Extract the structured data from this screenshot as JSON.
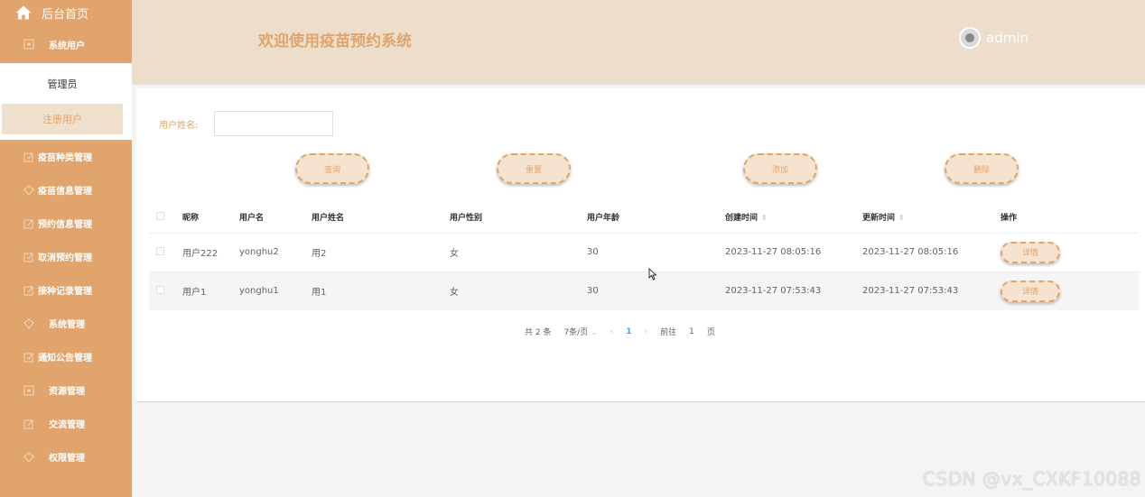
{
  "sidebar": {
    "home_label": "后台首页",
    "group_label": "系统用户",
    "sub_items": [
      "管理员",
      "注册用户"
    ],
    "items": [
      {
        "label": "疫苗种类管理",
        "icon": "edit-square-icon"
      },
      {
        "label": "疫苗信息管理",
        "icon": "diamond-icon"
      },
      {
        "label": "预约信息管理",
        "icon": "edit-icon"
      },
      {
        "label": "取消预约管理",
        "icon": "edit-square-icon"
      },
      {
        "label": "接种记录管理",
        "icon": "edit-icon"
      },
      {
        "label": "系统管理",
        "icon": "diamond-icon"
      },
      {
        "label": "通知公告管理",
        "icon": "edit-square-icon"
      },
      {
        "label": "资源管理",
        "icon": "square-dot-icon"
      },
      {
        "label": "交流管理",
        "icon": "edit-icon"
      },
      {
        "label": "权限管理",
        "icon": "diamond-icon"
      }
    ]
  },
  "header": {
    "title": "欢迎使用疫苗预约系统",
    "username": "admin"
  },
  "search": {
    "label": "用户姓名:",
    "value": ""
  },
  "buttons": {
    "query": "查询",
    "reset": "重置",
    "add": "添加",
    "delete": "删除"
  },
  "table": {
    "columns": [
      "昵称",
      "用户名",
      "用户姓名",
      "用户性别",
      "用户年龄",
      "创建时间",
      "更新时间",
      "操作"
    ],
    "rows": [
      {
        "nickname": "用户222",
        "username": "yonghu2",
        "name": "用2",
        "gender": "女",
        "age": "30",
        "created": "2023-11-27 08:05:16",
        "updated": "2023-11-27 08:05:16",
        "action": "详情"
      },
      {
        "nickname": "用户1",
        "username": "yonghu1",
        "name": "用1",
        "gender": "女",
        "age": "30",
        "created": "2023-11-27 07:53:43",
        "updated": "2023-11-27 07:53:43",
        "action": "详情"
      }
    ]
  },
  "pagination": {
    "total": "共 2 条",
    "page_size": "7条/页",
    "current": "1",
    "goto_prefix": "前往",
    "goto_value": "1",
    "goto_suffix": "页"
  },
  "watermark": "CSDN @vx_CXKF10088",
  "colors": {
    "accent": "#e0a46c",
    "header_bg": "#ecdecb",
    "active_sub_bg": "#eee0cc"
  }
}
